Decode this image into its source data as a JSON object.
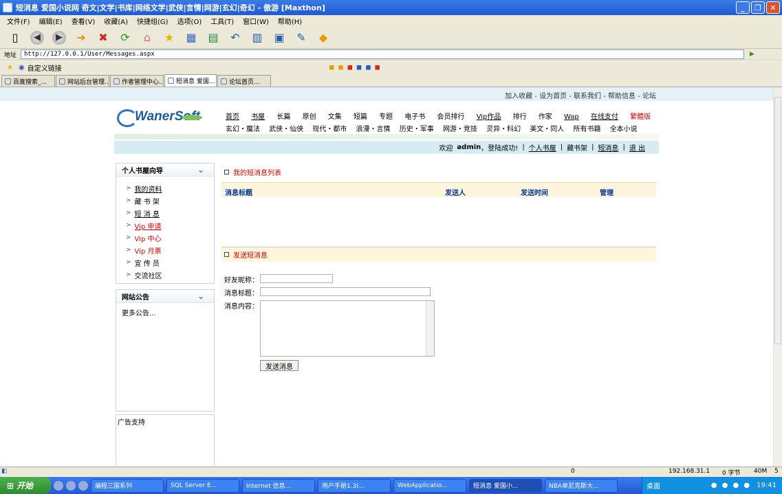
{
  "window": {
    "title": "短消息 爱国小说网 奇文|文学|书库|网络文学|武侠|言情|网游|玄幻|奇幻 - 傲游 [Maxthon]"
  },
  "menu": [
    "文件(F)",
    "编辑(E)",
    "查看(V)",
    "收藏(A)",
    "快捷组(G)",
    "选项(O)",
    "工具(T)",
    "窗口(W)",
    "帮助(H)"
  ],
  "address": {
    "label": "地址",
    "url": "http://127.0.0.1/User/Messages.aspx"
  },
  "favbar": {
    "label": "自定义链接"
  },
  "tabs": [
    "百度搜索_...",
    "网站后台管理...",
    "作者管理中心...",
    "短消息 爱国...",
    "论坛首页..."
  ],
  "site": {
    "toplinks": "加入收藏 - 设为首页 - 联系我们 - 帮助信息 - 论坛",
    "logo": "WanerSoft",
    "nav1": [
      "首页",
      "书屋",
      "长篇",
      "原创",
      "文集",
      "短篇",
      "专题",
      "电子书",
      "会员排行",
      "Vip作品",
      "排行",
      "作家",
      "Wap",
      "在线支付",
      "繁體版"
    ],
    "nav2": [
      "玄幻・魔法",
      "武侠・仙侠",
      "现代・都市",
      "浪漫・言情",
      "历史・军事",
      "网游・竞技",
      "灵异・科幻",
      "美文・同人",
      "所有书籍",
      "全本小说"
    ],
    "welcome": {
      "prefix": "欢迎",
      "user": "admin",
      "suffix": "，登陆成功!",
      "links": [
        "个人书屋",
        "藏书架",
        "短消息",
        "退 出"
      ]
    }
  },
  "sidebar": {
    "nav_title": "个人书屋向导",
    "items": [
      {
        "label": "我的资料"
      },
      {
        "label": "藏 书 架"
      },
      {
        "label": "短 消 息"
      },
      {
        "label": "Vip 申请"
      },
      {
        "label": "Vip 中心"
      },
      {
        "label": "Vip 月票"
      },
      {
        "label": "宣 传 员"
      },
      {
        "label": "交流社区"
      }
    ],
    "notice_title": "网站公告",
    "notice_more": "更多公告...",
    "ad_title": "广告支持"
  },
  "main": {
    "list_title": "我的短消息列表",
    "columns": [
      "消息标题",
      "发送人",
      "发送时间",
      "管理"
    ],
    "send_title": "发送短消息",
    "form": {
      "friend_label": "好友昵称：",
      "subject_label": "消息标题：",
      "content_label": "消息内容：",
      "send_button": "发送消息"
    }
  },
  "status": {
    "count": "0",
    "ip": "192.168.31.1",
    "bytes": "0 字节",
    "mem": "40M",
    "num": "5"
  },
  "taskbar": {
    "start": "开始",
    "tasks": [
      "编程三国系列",
      "SQL Server E...",
      "Internet 信息...",
      "用户手册1.3(...",
      "WebApplicatio...",
      "短消息 爱国小...",
      "NBA单尼克斯大..."
    ],
    "desk": "桌面",
    "clock": "19:41"
  }
}
